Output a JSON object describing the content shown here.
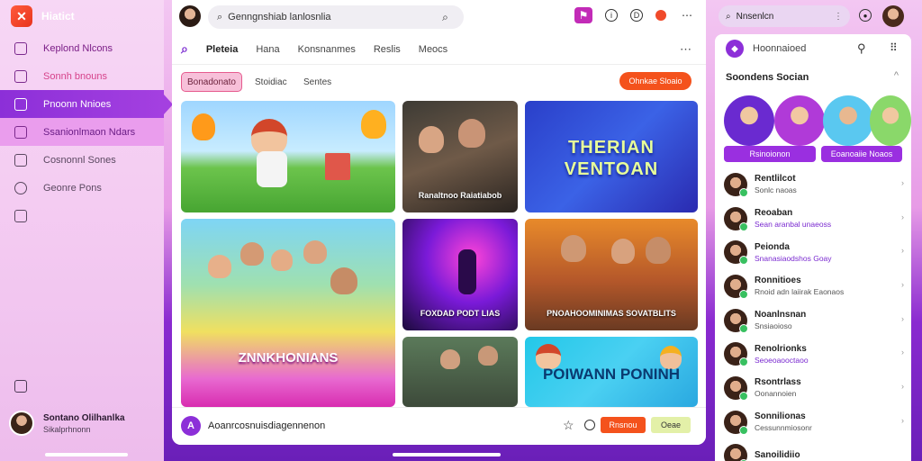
{
  "brand": {
    "name": "Hiatict",
    "logo_glyph": "✕"
  },
  "sidebar": {
    "items": [
      {
        "label": "Keplond Nlcons",
        "icon": "grid-icon",
        "state": "hl-none"
      },
      {
        "label": "Sonnh bnouns",
        "icon": "home-icon",
        "state": "none"
      },
      {
        "label": "Pnoonn Nnioes",
        "icon": "bookmark-icon",
        "state": "active"
      },
      {
        "label": "Ssanionlmaon Ndars",
        "icon": "heart-icon",
        "state": "hl"
      },
      {
        "label": "Cosnonnl Sones",
        "icon": "chat-icon",
        "state": "plain"
      },
      {
        "label": "Geonre Pons",
        "icon": "rocket-icon",
        "state": "plain"
      },
      {
        "label": "",
        "icon": "box-icon",
        "state": "plain"
      }
    ],
    "user": {
      "name": "Sontano Olilhanlka",
      "status": "Sikalprhnonn"
    }
  },
  "topbar": {
    "search_value": "Genngnshiab lanlosnlia",
    "icons": [
      "flag-icon",
      "info-icon",
      "id-icon",
      "record-icon",
      "more-icon"
    ]
  },
  "tabs": [
    "Pleteia",
    "Hana",
    "Konsnanmes",
    "Reslis",
    "Meocs"
  ],
  "filters": {
    "active": "Bonadonato",
    "second": "Stoidiac",
    "third": "Sentes",
    "cta": "Ohnkae Sloaio"
  },
  "cards": {
    "c2": "Ranaltnoo Raiatiabob",
    "c3": "THERIAN VENTOAN",
    "c4": "ZNNKHONIANS",
    "c5": "FOXDAD PODT LIAS",
    "c6": "PNOAHOOMINIMAS SOVATBLITS",
    "c8": "POIWANN PONINH"
  },
  "bottombar": {
    "text": "Aoanrcosnuisdiagennenon",
    "btn1": "Rnsnou",
    "btn2": "Oeae"
  },
  "right": {
    "search_value": "Nnsenlcn",
    "header_label": "Hoonnaioed",
    "section_title": "Soondens Socian",
    "story_btn1": "Rsinoionon",
    "story_btn2": "Eoanoaiie Noaos",
    "contacts": [
      {
        "name": "Rentlilcot",
        "sub": "Sonlc naoas",
        "accent": false
      },
      {
        "name": "Reoaban",
        "sub": "Sean aranbal unaeoss",
        "accent": true
      },
      {
        "name": "Peionda",
        "sub": "Snanasiaodshos Goay",
        "accent": true
      },
      {
        "name": "Ronnitioes",
        "sub": "Rnoid adn laiirak Eaonaos",
        "accent": false
      },
      {
        "name": "Noanlnsnan",
        "sub": "Snsiaoioso",
        "accent": false
      },
      {
        "name": "Renolrionks",
        "sub": "Seoeoaooctaoo",
        "accent": true
      },
      {
        "name": "Rsontrlass",
        "sub": "Oonannoien",
        "accent": false
      },
      {
        "name": "Sonnilionas",
        "sub": "Cessunnmiosonr",
        "accent": false
      },
      {
        "name": "Sanoilidiio",
        "sub": "",
        "accent": false
      }
    ]
  },
  "colors": {
    "accent": "#8c2fd8",
    "cta": "#f4521c",
    "online": "#38c060"
  }
}
